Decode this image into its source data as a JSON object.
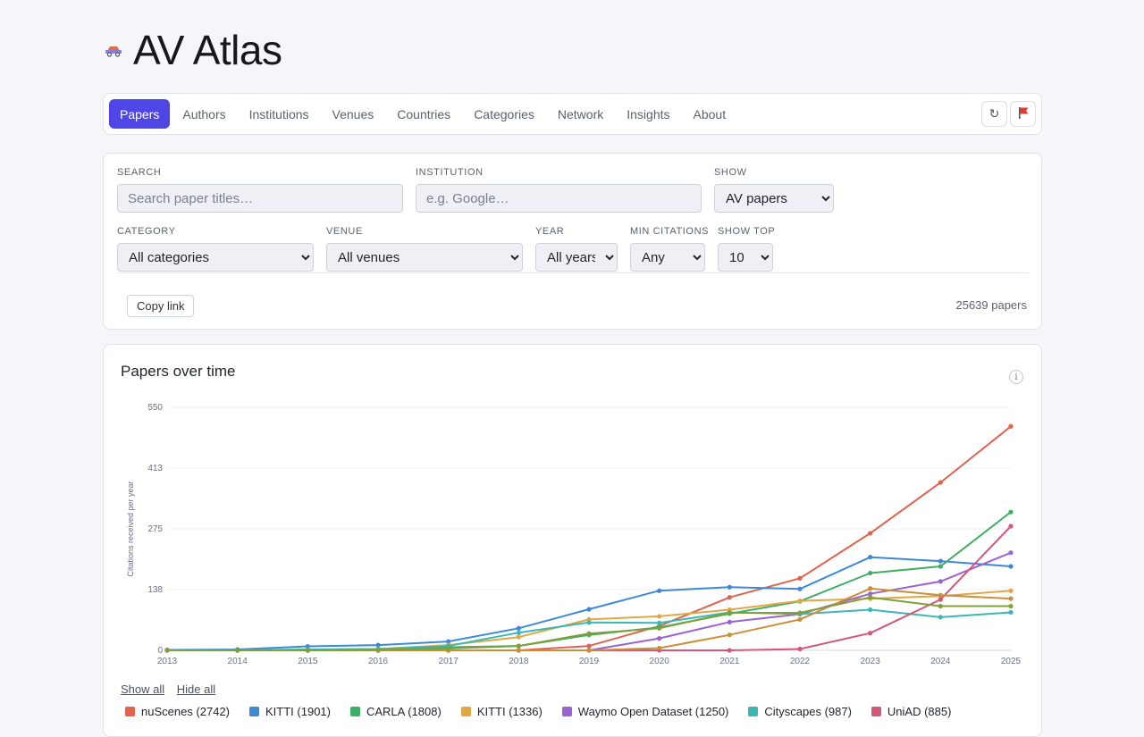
{
  "app": {
    "title": "AV Atlas",
    "logo_icon": "car-icon"
  },
  "nav": {
    "tabs": [
      {
        "label": "Papers",
        "active": true
      },
      {
        "label": "Authors"
      },
      {
        "label": "Institutions"
      },
      {
        "label": "Venues"
      },
      {
        "label": "Countries"
      },
      {
        "label": "Categories"
      },
      {
        "label": "Network"
      },
      {
        "label": "Insights"
      },
      {
        "label": "About"
      }
    ],
    "refresh_icon": "refresh-icon",
    "flag_icon": "flag-icon"
  },
  "filters": {
    "search": {
      "label": "SEARCH",
      "placeholder": "Search paper titles…",
      "value": ""
    },
    "institution": {
      "label": "INSTITUTION",
      "placeholder": "e.g. Google…",
      "value": ""
    },
    "show": {
      "label": "SHOW",
      "value": "AV papers"
    },
    "category": {
      "label": "CATEGORY",
      "value": "All categories"
    },
    "venue": {
      "label": "VENUE",
      "value": "All venues"
    },
    "year": {
      "label": "YEAR",
      "value": "All years"
    },
    "min_citations": {
      "label": "MIN CITATIONS",
      "value": "Any"
    },
    "show_top": {
      "label": "SHOW TOP",
      "value": "10"
    },
    "copy_link_label": "Copy link",
    "result_count": "25639 papers"
  },
  "chart_panel": {
    "title": "Papers over time",
    "info_icon": "info-icon",
    "show_all": "Show all",
    "hide_all": "Hide all"
  },
  "chart_data": {
    "type": "line",
    "title": "Papers over time",
    "xlabel": "",
    "ylabel": "Citations received per year",
    "ylim": [
      0,
      550
    ],
    "yticks": [
      "0",
      "138",
      "275",
      "413",
      "550"
    ],
    "x": [
      "2013",
      "2014",
      "2015",
      "2016",
      "2017",
      "2018",
      "2019",
      "2020",
      "2021",
      "2022",
      "2023",
      "2024",
      "2025"
    ],
    "grid": true,
    "legend_position": "bottom",
    "series": [
      {
        "name": "nuScenes (2742)",
        "color": "#e0634d",
        "values": [
          0,
          0,
          0,
          0,
          0,
          0,
          10,
          55,
          120,
          163,
          265,
          380,
          507
        ]
      },
      {
        "name": "KITTI (1901)",
        "color": "#3d89d6",
        "values": [
          1,
          2,
          9,
          12,
          20,
          50,
          93,
          135,
          143,
          139,
          211,
          202,
          190
        ]
      },
      {
        "name": "CARLA (1808)",
        "color": "#3fae62",
        "values": [
          0,
          0,
          1,
          2,
          7,
          10,
          35,
          52,
          83,
          111,
          175,
          190,
          313
        ]
      },
      {
        "name": "KITTI (1336)",
        "color": "#e2a744",
        "values": [
          0,
          0,
          2,
          3,
          12,
          30,
          70,
          77,
          92,
          112,
          117,
          123,
          135
        ]
      },
      {
        "name": "Waymo Open Dataset (1250)",
        "color": "#9a62d2",
        "values": [
          0,
          0,
          0,
          0,
          0,
          0,
          0,
          27,
          64,
          82,
          128,
          156,
          221
        ]
      },
      {
        "name": "Cityscapes (987)",
        "color": "#3bb8b5",
        "values": [
          0,
          0,
          2,
          3,
          10,
          40,
          63,
          62,
          86,
          82,
          92,
          75,
          86
        ]
      },
      {
        "name": "UniAD (885)",
        "color": "#d4577a",
        "values": [
          0,
          0,
          0,
          0,
          0,
          0,
          0,
          0,
          0,
          3,
          39,
          115,
          281
        ]
      },
      {
        "name": "",
        "color": "#c98f3a",
        "values": [
          0,
          0,
          0,
          0,
          0,
          0,
          0,
          5,
          35,
          70,
          140,
          125,
          117
        ]
      },
      {
        "name": "",
        "color": "#7fa03a",
        "values": [
          0,
          0,
          0,
          1,
          4,
          10,
          38,
          50,
          85,
          85,
          120,
          100,
          100
        ]
      }
    ]
  }
}
